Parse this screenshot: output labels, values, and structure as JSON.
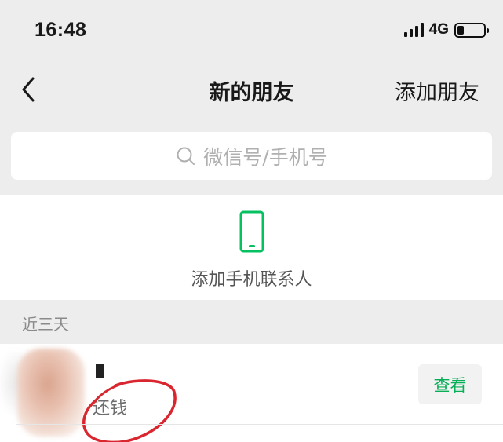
{
  "status_bar": {
    "time": "16:48",
    "network": "4G",
    "battery_level": 0.2
  },
  "nav": {
    "title": "新的朋友",
    "action_label": "添加朋友",
    "back_icon": "chevron-left-icon"
  },
  "search": {
    "placeholder": "微信号/手机号",
    "icon": "search-icon"
  },
  "add_phone_contacts": {
    "label": "添加手机联系人",
    "icon": "mobile-phone-icon",
    "icon_color": "#07c160"
  },
  "recent_section": {
    "header": "近三天",
    "requests": [
      {
        "message": "还钱",
        "button_label": "查看"
      }
    ]
  },
  "colors": {
    "accent_green": "#06ae56",
    "annotation_red": "#d9262f",
    "background": "#ededed"
  }
}
